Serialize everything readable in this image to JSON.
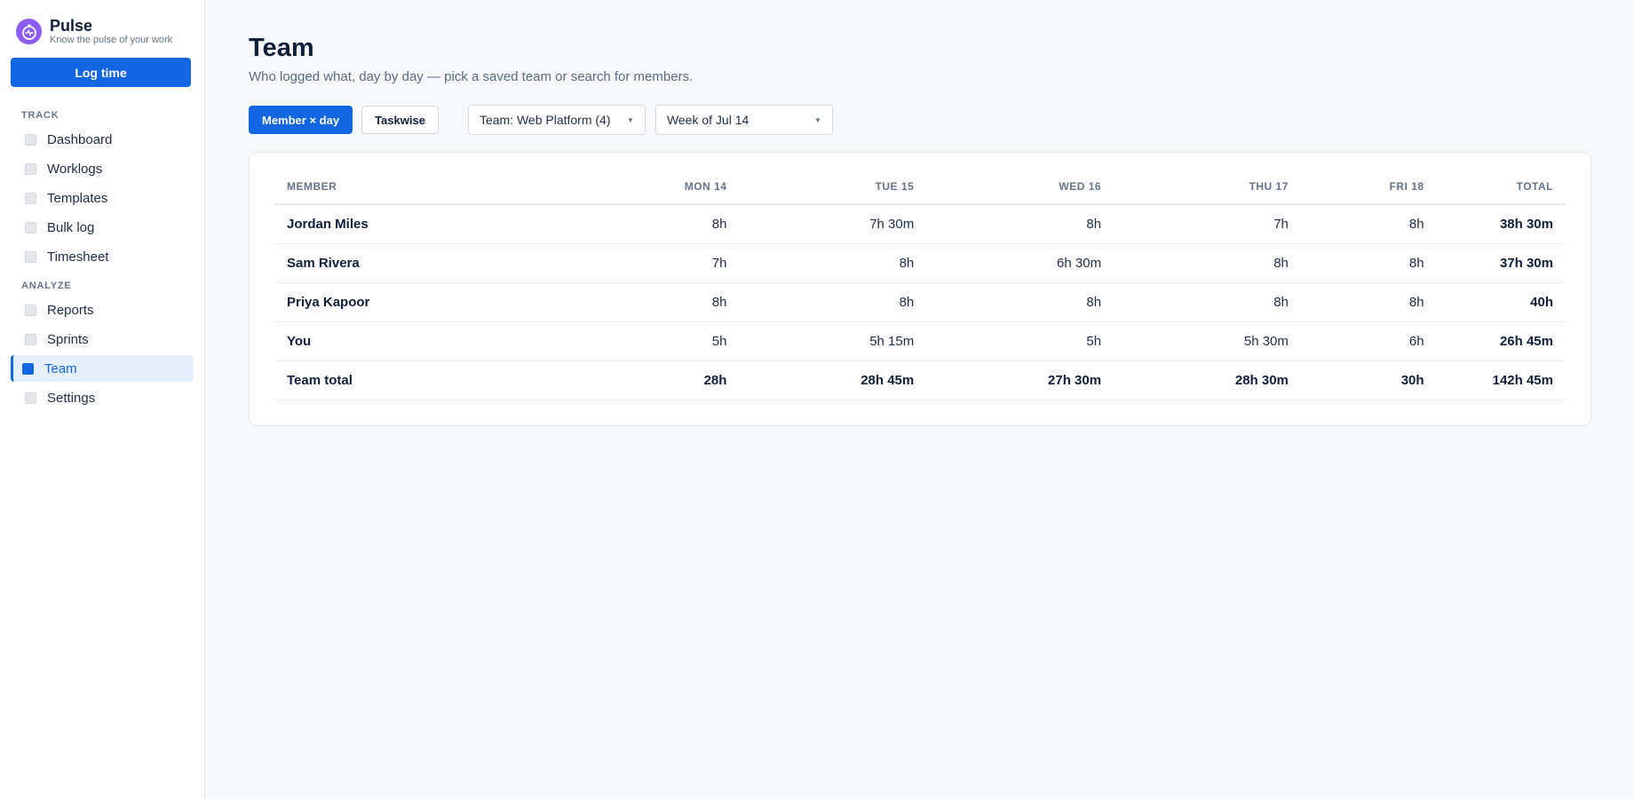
{
  "brand": {
    "name": "Pulse",
    "tagline": "Know the pulse of your work"
  },
  "sidebar": {
    "log_button": "Log time",
    "sections": [
      {
        "label": "TRACK",
        "items": [
          "Dashboard",
          "Worklogs",
          "Templates",
          "Bulk log",
          "Timesheet"
        ]
      },
      {
        "label": "ANALYZE",
        "items": [
          "Reports",
          "Sprints",
          "Team",
          "Settings"
        ]
      }
    ],
    "active_item": "Team"
  },
  "page": {
    "title": "Team",
    "subtitle": "Who logged what, day by day — pick a saved team or search for members."
  },
  "toolbar": {
    "view_member_day": "Member × day",
    "view_taskwise": "Taskwise",
    "team_select": "Team: Web Platform (4)",
    "week_select": "Week of Jul 14"
  },
  "table": {
    "columns": [
      "MEMBER",
      "MON 14",
      "TUE 15",
      "WED 16",
      "THU 17",
      "FRI 18",
      "TOTAL"
    ],
    "rows": [
      [
        "Jordan Miles",
        "8h",
        "7h 30m",
        "8h",
        "7h",
        "8h",
        "38h 30m"
      ],
      [
        "Sam Rivera",
        "7h",
        "8h",
        "6h 30m",
        "8h",
        "8h",
        "37h 30m"
      ],
      [
        "Priya Kapoor",
        "8h",
        "8h",
        "8h",
        "8h",
        "8h",
        "40h"
      ],
      [
        "You",
        "5h",
        "5h 15m",
        "5h",
        "5h 30m",
        "6h",
        "26h 45m"
      ]
    ],
    "total_row": [
      "Team total",
      "28h",
      "28h 45m",
      "27h 30m",
      "28h 30m",
      "30h",
      "142h 45m"
    ]
  },
  "colors": {
    "accent": "#1366e1",
    "logo": "#8b5cf6",
    "active_bg": "#e6f0fc"
  },
  "icons": {
    "logo": "stopwatch-icon",
    "nav": "square-icon",
    "caret": "chevron-down-icon"
  }
}
